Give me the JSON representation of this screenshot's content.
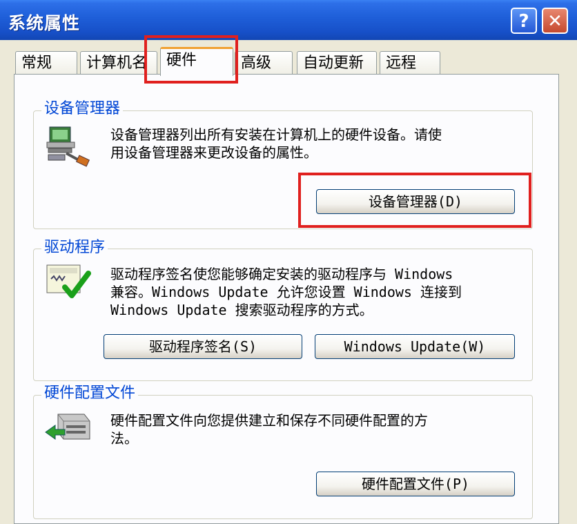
{
  "window": {
    "title": "系统属性",
    "help_label": "?",
    "close_label": "✕"
  },
  "tabs": [
    {
      "label": "常规"
    },
    {
      "label": "计算机名"
    },
    {
      "label": "硬件"
    },
    {
      "label": "高级"
    },
    {
      "label": "自动更新"
    },
    {
      "label": "远程"
    }
  ],
  "device_manager": {
    "label": "设备管理器",
    "description_line1": "设备管理器列出所有安装在计算机上的硬件设备。请使",
    "description_line2": "用设备管理器来更改设备的属性。",
    "button": "设备管理器(D)",
    "icon": "device-manager-icon"
  },
  "drivers": {
    "label": "驱动程序",
    "description_line1": "驱动程序签名使您能够确定安装的驱动程序与 Windows",
    "description_line2": "兼容。Windows Update 允许您设置 Windows 连接到",
    "description_line3": "Windows Update 搜索驱动程序的方式。",
    "signing_button": "驱动程序签名(S)",
    "update_button": "Windows Update(W)",
    "icon": "driver-signing-icon"
  },
  "hardware_profiles": {
    "label": "硬件配置文件",
    "description_line1": "硬件配置文件向您提供建立和保存不同硬件配置的方",
    "description_line2": "法。",
    "button": "硬件配置文件(P)",
    "icon": "hardware-profile-icon"
  },
  "colors": {
    "highlight": "#E0201E",
    "group_label": "#0046D5",
    "titlebar": "#1E5ED8"
  }
}
